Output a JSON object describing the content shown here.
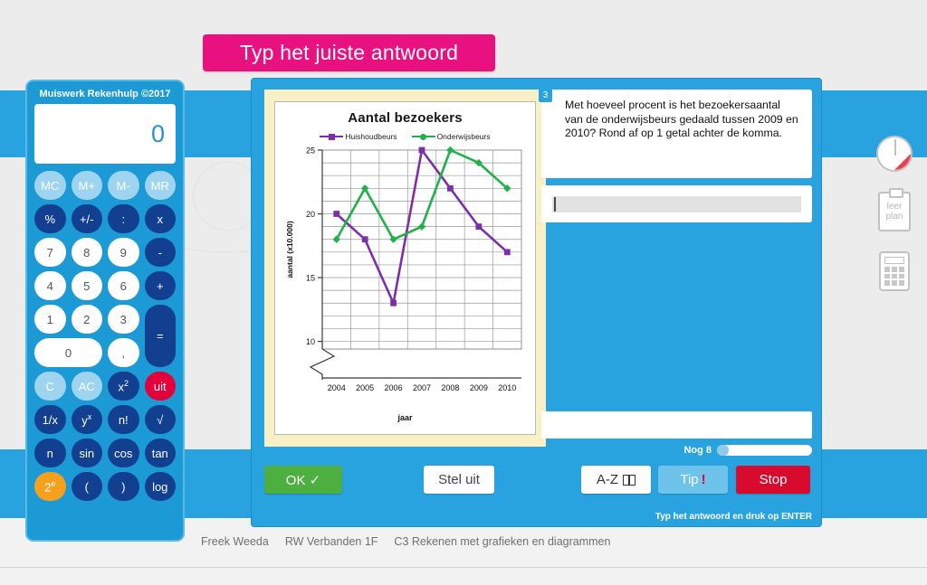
{
  "banner": {
    "title": "Typ het juiste antwoord"
  },
  "calculator": {
    "title": "Muiswerk Rekenhulp ©2017",
    "display_value": "0",
    "keys": [
      {
        "label": "MC",
        "style": "mem"
      },
      {
        "label": "M+",
        "style": "mem"
      },
      {
        "label": "M-",
        "style": "mem"
      },
      {
        "label": "MR",
        "style": "mem"
      },
      {
        "label": "%",
        "style": "dark"
      },
      {
        "label": "+/-",
        "style": "dark"
      },
      {
        "label": ":",
        "style": "dark"
      },
      {
        "label": "x",
        "style": "dark"
      },
      {
        "label": "7",
        "style": "num"
      },
      {
        "label": "8",
        "style": "num"
      },
      {
        "label": "9",
        "style": "num"
      },
      {
        "label": "-",
        "style": "dark"
      },
      {
        "label": "4",
        "style": "num"
      },
      {
        "label": "5",
        "style": "num"
      },
      {
        "label": "6",
        "style": "num"
      },
      {
        "label": "+",
        "style": "dark"
      },
      {
        "label": "1",
        "style": "num"
      },
      {
        "label": "2",
        "style": "num"
      },
      {
        "label": "3",
        "style": "num"
      },
      {
        "label": "=",
        "style": "dark tall"
      },
      {
        "label": "0",
        "style": "num wide"
      },
      {
        "label": ",",
        "style": "num"
      },
      {
        "label": "C",
        "style": "light"
      },
      {
        "label": "AC",
        "style": "light"
      },
      {
        "label": "x2",
        "style": "dark"
      },
      {
        "label": "uit",
        "style": "red"
      },
      {
        "label": "1/x",
        "style": "dark"
      },
      {
        "label": "yx",
        "style": "dark"
      },
      {
        "label": "n!",
        "style": "dark"
      },
      {
        "label": "√",
        "style": "dark"
      },
      {
        "label": "n",
        "style": "dark"
      },
      {
        "label": "sin",
        "style": "dark"
      },
      {
        "label": "cos",
        "style": "dark"
      },
      {
        "label": "tan",
        "style": "dark"
      },
      {
        "label": "2e",
        "style": "orange"
      },
      {
        "label": "(",
        "style": "dark"
      },
      {
        "label": ")",
        "style": "dark"
      },
      {
        "label": "log",
        "style": "dark"
      }
    ]
  },
  "exercise": {
    "question_number": "3",
    "question_text": "Met hoeveel procent is het bezoekersaantal van de onderwijsbeurs gedaald tussen 2009 en 2010? Rond af op 1 getal achter de komma.",
    "answer_value": "",
    "feedback_text": "",
    "progress_label": "Nog 8",
    "hint_text": "Typ het antwoord en druk op ENTER",
    "buttons": {
      "ok": "OK ✓",
      "postpone": "Stel uit",
      "dictionary": "A-Z",
      "tip": "Tip",
      "tip_mark": "!",
      "stop": "Stop"
    }
  },
  "meta": {
    "student": "Freek Weeda",
    "course": "RW Verbanden 1F",
    "topic": "C3 Rekenen met grafieken en diagrammen"
  },
  "rail": {
    "progress_icon": "pie-progress-icon",
    "plan_line1": "leer",
    "plan_line2": "plan",
    "calculator_icon": "calculator-icon"
  },
  "chart_data": {
    "type": "line",
    "title": "Aantal bezoekers",
    "xlabel": "jaar",
    "ylabel": "aantal (x10.000)",
    "categories": [
      "2004",
      "2005",
      "2006",
      "2007",
      "2008",
      "2009",
      "2010"
    ],
    "ylim": [
      9,
      25
    ],
    "yticks": [
      10,
      15,
      20,
      25
    ],
    "grid": true,
    "axis_break": true,
    "legend_position": "top",
    "series": [
      {
        "name": "Huishoudbeurs",
        "color": "#7d2fa8",
        "marker": "square",
        "values": [
          20,
          18,
          13,
          25,
          22,
          19,
          17
        ]
      },
      {
        "name": "Onderwijsbeurs",
        "color": "#21b14b",
        "marker": "diamond",
        "values": [
          18,
          22,
          18,
          19,
          25,
          24,
          22
        ]
      }
    ]
  }
}
